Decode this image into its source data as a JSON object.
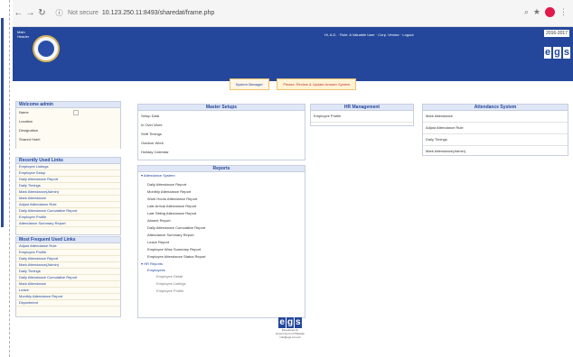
{
  "browser": {
    "security": "Not secure",
    "url": "10.123.250.11:8493/sharedat/frame.php"
  },
  "header": {
    "caption": [
      "Main",
      "Header"
    ],
    "info": "Hi, A.D. · Role: A Valuable User · Corp. Vendor · Logout",
    "date": "2016-2017",
    "brand": [
      "e",
      "g",
      "s"
    ]
  },
  "actions": {
    "buttons": [
      "System Manager",
      "Please: Review & Update Answer System"
    ]
  },
  "welcome": {
    "title": "Welcome admin",
    "fields": [
      "Name",
      "Location",
      "Designation",
      "Shared Hotel"
    ]
  },
  "recent": {
    "title": "Recently Used Links",
    "items": [
      "Employee Listings",
      "Employee Setup",
      "Daily Attendance Report",
      "Daily Timings",
      "Mark Attendance(Admin)",
      "Mark Attendance",
      "Adjust Attendance Rule",
      "Daily Attendance Cumulative Report",
      "Employee Profile",
      "Attendance Summary Report"
    ]
  },
  "mostused": {
    "title": "Most Frequent Used Links",
    "items": [
      "Adjust Attendance Rule",
      "Employee Profile",
      "Daily Attendance Report",
      "Mark Attendance(Admin)",
      "Daily Timings",
      "Daily Attendance Cumulative Report",
      "Mark Attendance",
      "Leave",
      "Monthly Attendance Report",
      "Department"
    ]
  },
  "master": {
    "title": "Master Setups",
    "items": [
      "Setup Data",
      "In Over Work",
      "Shift Timings",
      "Outdoor Work",
      "Holiday Calendar"
    ]
  },
  "hrm": {
    "title": "HR Management",
    "items": [
      "Employee Profile"
    ]
  },
  "att": {
    "title": "Attendance System",
    "items": [
      "Mark Attendance",
      "Adjust Attendance Rule",
      "Daily Timings",
      "Mark Attendance(Admin)"
    ]
  },
  "reports": {
    "title": "Reports",
    "section1": "Attendance System",
    "items1": [
      "Daily Attendance Report",
      "Monthly Attendance Report",
      "Work Hours Attendance Report",
      "Late Arrival Attendance Report",
      "Late Sitting Attendance Report",
      "Absent Report",
      "Daily Attendance Cumulative Report",
      "Attendance Summary Report",
      "Leave Report",
      "Employee Wise Summary Report",
      "Employee Attendance Status Report"
    ],
    "section2": "HR Reports",
    "sub2": "Employees",
    "items2": [
      "Employee Detail",
      "Employee Listings",
      "Employee Profile"
    ]
  },
  "footer": {
    "brand": [
      "e",
      "g",
      "s"
    ],
    "lines": [
      "Developed by",
      "Government of Pakistan",
      "info@egs.com.pk"
    ]
  }
}
